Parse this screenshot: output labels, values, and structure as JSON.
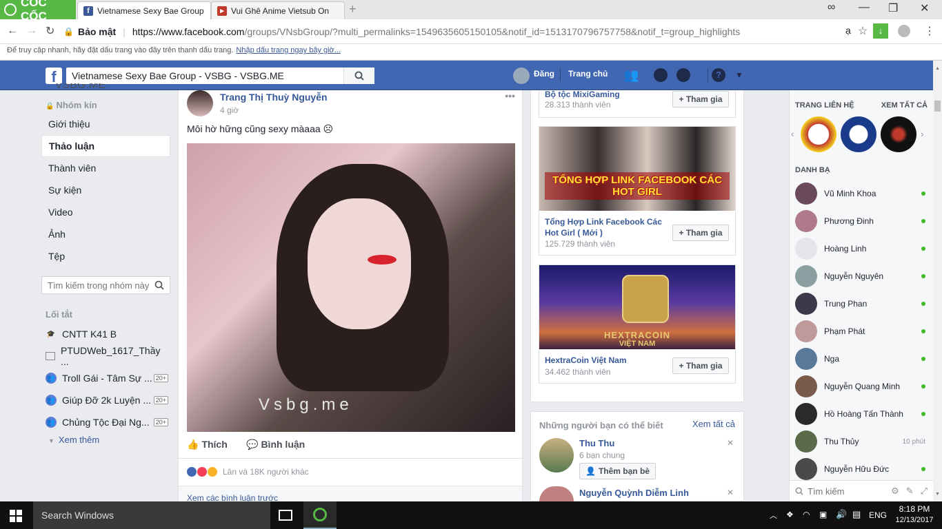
{
  "browser": {
    "brand": "CỐC CỐC",
    "tabs": [
      {
        "title": "Vietnamese Sexy Bae Group"
      },
      {
        "title": "Vui Ghê Anime Vietsub On"
      }
    ],
    "security_label": "Bảo mật",
    "url_prefix": "https://www.facebook.com",
    "url_rest": "/groups/VNsbGroup/?multi_permalinks=1549635605150105&notif_id=1513170796757758&notif_t=group_highlights",
    "bookmark_hint": "Để truy cập nhanh, hãy đặt dấu trang vào đây trên thanh dấu trang.",
    "bookmark_link": "Nhập dấu trang ngay bây giờ..."
  },
  "fb_header": {
    "search_value": "Vietnamese Sexy Bae Group - VSBG - VSBG.ME",
    "user_label": "Đăng",
    "home_label": "Trang chủ"
  },
  "left_nav": {
    "group_partial": "VSBG.ME",
    "privacy": "Nhóm kín",
    "items": [
      {
        "label": "Giới thiệu"
      },
      {
        "label": "Thảo luận"
      },
      {
        "label": "Thành viên"
      },
      {
        "label": "Sự kiện"
      },
      {
        "label": "Video"
      },
      {
        "label": "Ảnh"
      },
      {
        "label": "Tệp"
      }
    ],
    "group_search_placeholder": "Tìm kiếm trong nhóm này",
    "shortcuts_title": "Lối tắt",
    "shortcuts": [
      {
        "label": "CNTT K41 B",
        "badge": ""
      },
      {
        "label": "PTUDWeb_1617_Thầy ...",
        "badge": ""
      },
      {
        "label": "Troll Gái - Tâm Sự ...",
        "badge": "20+"
      },
      {
        "label": "Giúp Đỡ 2k Luyện ...",
        "badge": "20+"
      },
      {
        "label": "Chủng Tộc Đại Ng...",
        "badge": "20+"
      }
    ],
    "see_more": "Xem thêm"
  },
  "post": {
    "author": "Trang Thị Thuỳ Nguyễn",
    "time": "4 giờ",
    "text": "Môi hờ hững cũng sexy màaaa ☹",
    "watermark": "Vsbg.me",
    "like_label": "Thích",
    "comment_label": "Bình luận",
    "reactions_text": "Lân và 18K người khác",
    "view_comments": "Xem các bình luận trước"
  },
  "suggested_groups": [
    {
      "name": "Bộ tộc MixiGaming",
      "members": "28.313 thành viên",
      "join": "Tham gia"
    },
    {
      "name": "Tổng Hợp Link Facebook Các Hot Girl ( Mới )",
      "members": "125.729 thành viên",
      "join": "Tham gia",
      "banner_text": "TỔNG HỢP LINK FACEBOOK CÁC HOT GIRL"
    },
    {
      "name": "HextraCoin Việt Nam",
      "members": "34.462 thành viên",
      "join": "Tham gia",
      "banner_text": "HEXTRACOIN",
      "banner_sub": "VIỆT NAM"
    }
  ],
  "people_you_may_know": {
    "title": "Những người bạn có thể biết",
    "see_all": "Xem tất cả",
    "people": [
      {
        "name": "Thu Thu",
        "mutual": "6 bạn chung",
        "add_label": "Thêm bạn bè"
      },
      {
        "name": "Nguyễn Quỳnh Diễm Linh",
        "mutual": "",
        "add_label": ""
      }
    ]
  },
  "chat": {
    "pages_title": "TRANG LIÊN HỆ",
    "see_all": "XEM TẤT CẢ",
    "contacts_title": "DANH BẠ",
    "contacts": [
      {
        "name": "Vũ Minh Khoa",
        "status": "online",
        "color": "#6a4a5a"
      },
      {
        "name": "Phương Đinh",
        "status": "online",
        "color": "#b07a8a"
      },
      {
        "name": "Hoàng Linh",
        "status": "online",
        "color": "#e4e6eb"
      },
      {
        "name": "Nguyễn Nguyên",
        "status": "online",
        "color": "#8aa0a0"
      },
      {
        "name": "Trung Phan",
        "status": "online",
        "color": "#3a3a4a"
      },
      {
        "name": "Phạm Phát",
        "status": "online",
        "color": "#c09a9a"
      },
      {
        "name": "Nga",
        "status": "online",
        "color": "#5a7a9a"
      },
      {
        "name": "Nguyễn Quang Minh",
        "status": "online",
        "color": "#7a5a4a"
      },
      {
        "name": "Hồ Hoàng Tấn Thành",
        "status": "online",
        "color": "#2a2a2a"
      },
      {
        "name": "Thu Thủy",
        "status": "10 phút",
        "color": "#5a6a4a"
      },
      {
        "name": "Nguyễn Hữu Đức",
        "status": "online",
        "color": "#4a4a4a"
      }
    ],
    "search_placeholder": "Tìm kiếm"
  },
  "taskbar": {
    "search_placeholder": "Search Windows",
    "language": "ENG",
    "time": "8:18 PM",
    "date": "12/13/2017"
  },
  "colors": {
    "fb_blue": "#4267b2",
    "link_blue": "#365899",
    "coccoc_green": "#57b846",
    "online_green": "#42b72a"
  }
}
